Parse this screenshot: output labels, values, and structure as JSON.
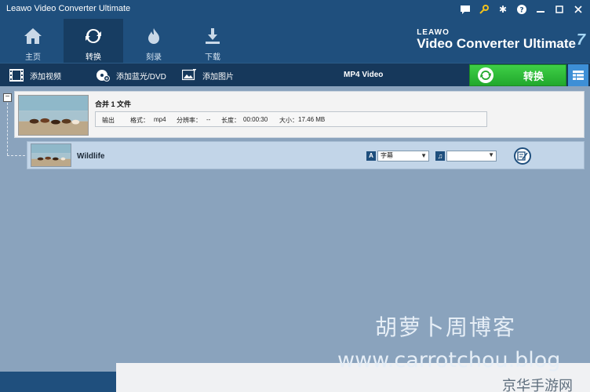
{
  "window": {
    "title": "Leawo Video Converter Ultimate"
  },
  "nav": {
    "tabs": [
      {
        "label": "主页"
      },
      {
        "label": "转换"
      },
      {
        "label": "刻录"
      },
      {
        "label": "下载"
      }
    ],
    "active": "转换"
  },
  "brand": {
    "top": "LEAWO",
    "product": "Video Converter Ultimate",
    "version": "7"
  },
  "toolbar": {
    "add_video": "添加视频",
    "add_bluray": "添加蓝光/DVD",
    "add_photo": "添加图片",
    "profile": "MP4 Video",
    "convert": "转换"
  },
  "merge": {
    "title": "合并 1 文件",
    "output_label": "输出",
    "format_label": "格式：",
    "format_value": "mp4",
    "resolution_label": "分辨率：",
    "resolution_value": "--",
    "duration_label": "长度：",
    "duration_value": "00:00:30",
    "size_label": "大小：",
    "size_value": "17.46 MB"
  },
  "file": {
    "name": "Wildlife",
    "subtitle_icon": "A",
    "subtitle_value": "字幕",
    "audio_value": ""
  },
  "watermark": {
    "line1": "胡萝卜周博客",
    "line2": "www.carrotchou.blog",
    "corner": "京华手游网"
  },
  "colors": {
    "titlebar": "#1f4f7d",
    "toolbar": "#16385b",
    "convert_green": "#2bb534",
    "content_bg": "#8aa3bd"
  },
  "icons": {
    "home": "home-icon",
    "convert": "convert-icon",
    "burn": "burn-icon",
    "download": "download-icon",
    "chat": "chat-icon",
    "key": "key-icon",
    "settings": "gear-icon",
    "help": "help-icon",
    "minimize": "minimize-icon",
    "maximize": "maximize-icon",
    "close": "close-icon"
  }
}
